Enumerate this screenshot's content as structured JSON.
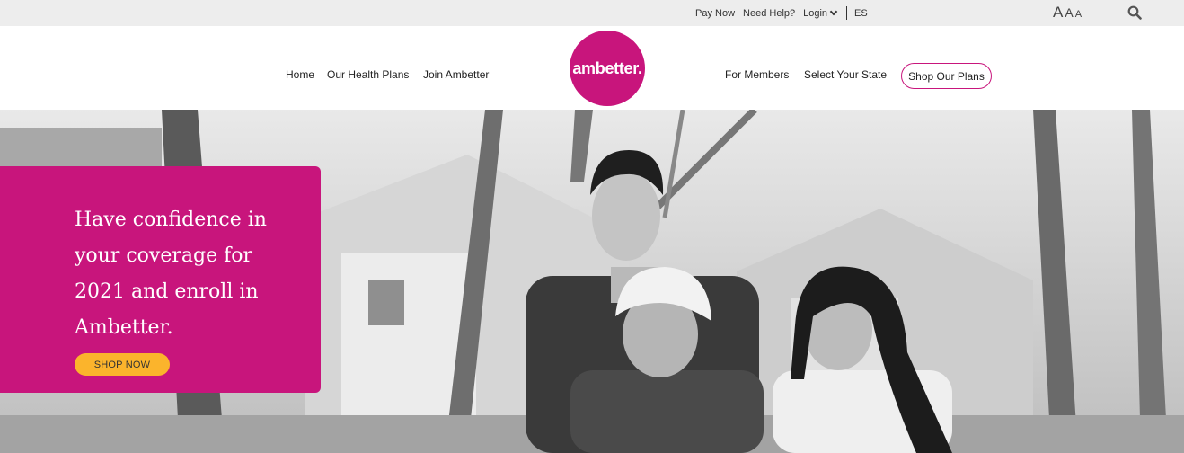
{
  "utility": {
    "pay_now": "Pay Now",
    "need_help": "Need Help?",
    "login": "Login",
    "language": "ES",
    "font_sizes": [
      "A",
      "A",
      "A"
    ],
    "search_icon": "search-icon"
  },
  "nav": {
    "home": "Home",
    "our_health_plans": "Our Health Plans",
    "join_ambetter": "Join Ambetter",
    "for_members": "For Members",
    "select_your_state": "Select Your State",
    "shop_our_plans": "Shop Our Plans"
  },
  "logo": {
    "text": "ambetter."
  },
  "hero": {
    "heading": "Have confidence in your coverage for 2021 and enroll in Ambetter.",
    "cta": "SHOP NOW"
  },
  "colors": {
    "brand_magenta": "#c8157c",
    "cta_yellow": "#fbb42c",
    "utility_bg": "#ededed"
  }
}
